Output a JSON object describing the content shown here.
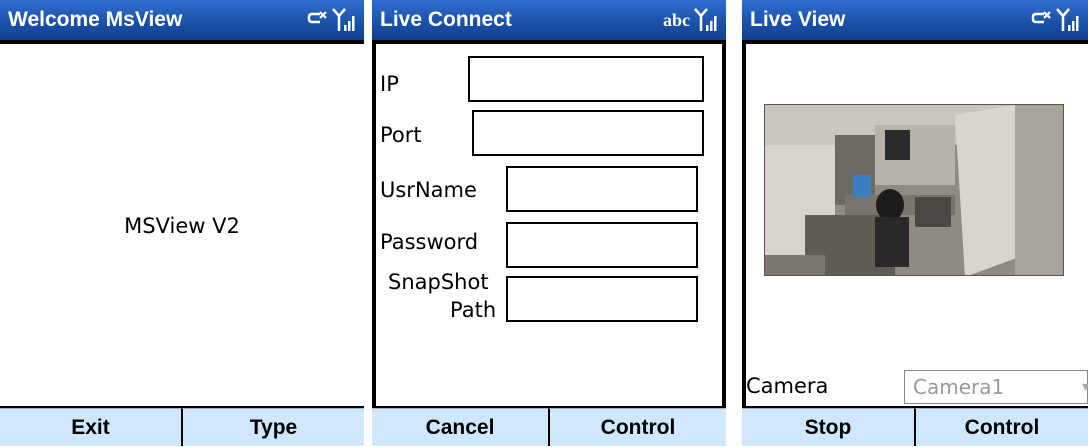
{
  "screens": [
    {
      "title": "Welcome MsView",
      "center_text": "MSView V2",
      "softkeys": [
        "Exit",
        "Type"
      ]
    },
    {
      "title": "Live Connect",
      "input_mode": "abc",
      "fields": [
        {
          "label": "IP",
          "value": ""
        },
        {
          "label": "Port",
          "value": ""
        },
        {
          "label": "UsrName",
          "value": ""
        },
        {
          "label": "Password",
          "value": ""
        },
        {
          "label_line1": "SnapShot",
          "label_line2": "Path",
          "value": ""
        }
      ],
      "softkeys": [
        "Cancel",
        "Control"
      ]
    },
    {
      "title": "Live View",
      "camera_label": "Camera",
      "camera_selected": "Camera1",
      "softkeys": [
        "Stop",
        "Control"
      ]
    }
  ],
  "colors": {
    "titlebar": "#1a4fa8",
    "softkey_bg": "#cfe8ff"
  },
  "icons": [
    "connection-icon",
    "signal-strength-icon"
  ]
}
